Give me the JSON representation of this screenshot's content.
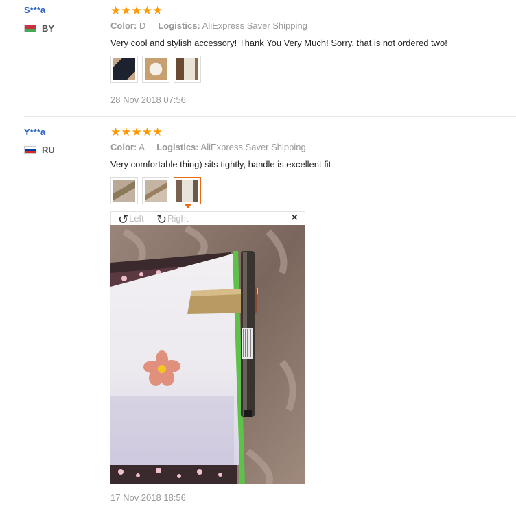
{
  "reviews": [
    {
      "user": "S***a",
      "country": "BY",
      "stars": "★★★★★",
      "color_label": "Color:",
      "color_value": "D",
      "logistics_label": "Logistics:",
      "logistics_value": "AliExpress Saver Shipping",
      "feedback": "Very cool and stylish accessory! Thank You Very Much! Sorry, that is not ordered two!",
      "date": "28 Nov 2018 07:56"
    },
    {
      "user": "Y***a",
      "country": "RU",
      "stars": "★★★★★",
      "color_label": "Color:",
      "color_value": "A",
      "logistics_label": "Logistics:",
      "logistics_value": "AliExpress Saver Shipping",
      "feedback": "Very comfortable thing) sits tightly, handle is excellent fit",
      "date": "17 Nov 2018 18:56"
    }
  ],
  "viewer": {
    "rotate_left": "Left",
    "rotate_right": "Right",
    "close": "×"
  },
  "colors": {
    "star": "#ff9900",
    "username": "#2a63c2",
    "active_thumb": "#e86b14"
  },
  "icons": [
    "rotate-left-icon",
    "rotate-right-icon",
    "close-icon"
  ]
}
